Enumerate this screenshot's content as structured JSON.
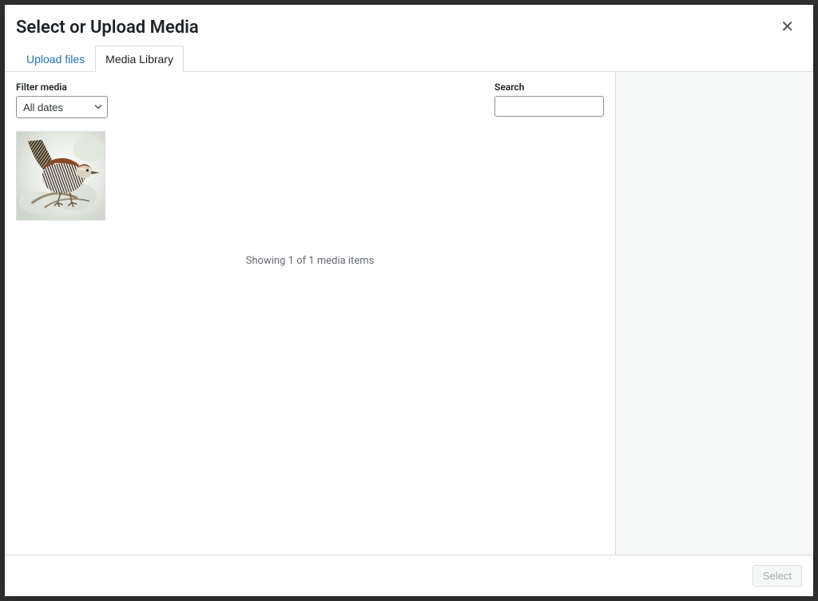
{
  "modal": {
    "title": "Select or Upload Media"
  },
  "tabs": {
    "upload": "Upload files",
    "library": "Media Library"
  },
  "filter": {
    "label": "Filter media",
    "selected": "All dates"
  },
  "search": {
    "label": "Search",
    "value": ""
  },
  "status": "Showing 1 of 1 media items",
  "footer": {
    "select": "Select"
  },
  "thumbnail": {
    "alt": "bird-illustration"
  }
}
